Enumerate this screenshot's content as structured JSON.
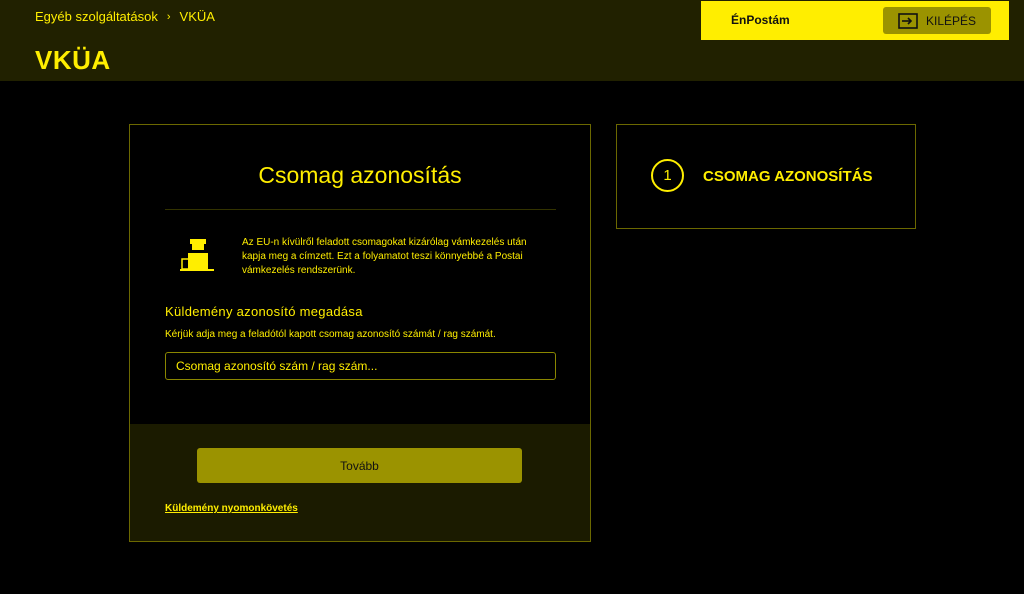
{
  "header": {
    "breadcrumb": [
      "Egyéb szolgáltatások",
      "VKÜA"
    ],
    "breadcrumb_separator": "›",
    "title": "VKÜA",
    "user_name": "ÉnPostám",
    "logout_label": "KILÉPÉS",
    "logout_icon": "logout-icon"
  },
  "card": {
    "title": "Csomag azonosítás",
    "info_icon": "customs-officer-icon",
    "info_text": "Az EU-n kívülről feladott csomagokat kizárólag vámkezelés után kapja meg a címzett. Ezt a folyamatot teszi könnyebbé a Postai vámkezelés rendszerünk.",
    "section_heading": "Küldemény azonosító megadása",
    "section_hint": "Kérjük adja meg a feladótól kapott csomag azonosító számát / rag számát.",
    "input_value": "",
    "input_placeholder": "Csomag azonosító szám / rag szám...",
    "next_button": "Tovább",
    "track_link": "Küldemény nyomonkövetés"
  },
  "steps": [
    {
      "number": "1",
      "label": "CSOMAG AZONOSÍTÁS"
    }
  ],
  "colors": {
    "accent": "#ffee00",
    "header_bg": "#212100",
    "button_bg": "#9b9300",
    "footer_bg": "#1b1b00",
    "border": "#6b6800"
  }
}
